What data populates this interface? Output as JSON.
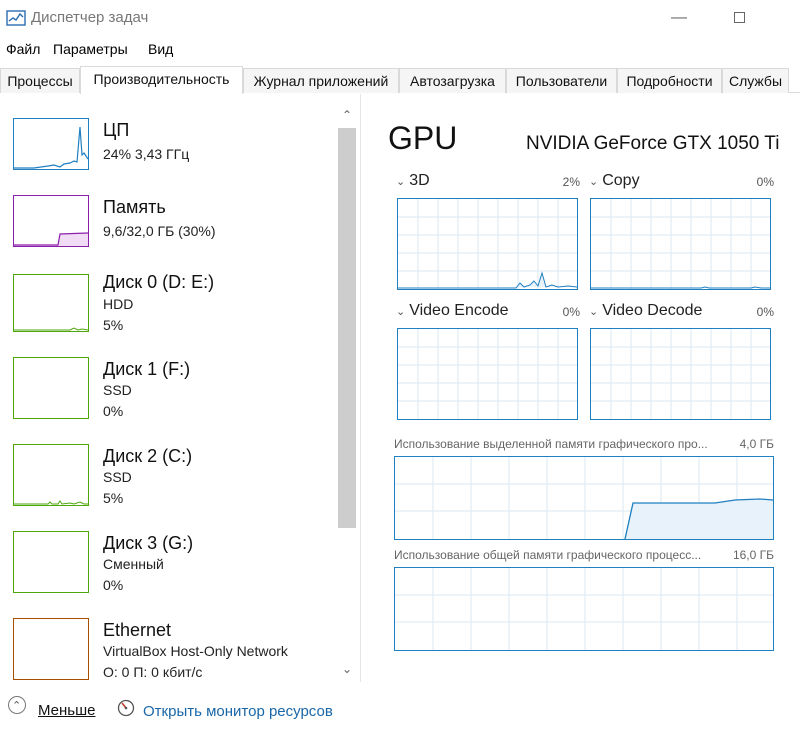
{
  "window": {
    "title": "Диспетчер задач",
    "minimize": "—"
  },
  "menu": {
    "file": "Файл",
    "options": "Параметры",
    "view": "Вид"
  },
  "tabs": [
    {
      "label": "Процессы"
    },
    {
      "label": "Производительность"
    },
    {
      "label": "Журнал приложений"
    },
    {
      "label": "Автозагрузка"
    },
    {
      "label": "Пользователи"
    },
    {
      "label": "Подробности"
    },
    {
      "label": "Службы"
    }
  ],
  "sidebar": {
    "items": [
      {
        "title": "ЦП",
        "line1": "24% 3,43 ГГц",
        "line2": "",
        "color": "#1f7fc1"
      },
      {
        "title": "Память",
        "line1": "9,6/32,0 ГБ (30%)",
        "line2": "",
        "color": "#8b1fa9"
      },
      {
        "title": "Диск 0 (D: E:)",
        "line1": "HDD",
        "line2": "5%",
        "color": "#4da60c"
      },
      {
        "title": "Диск 1 (F:)",
        "line1": "SSD",
        "line2": "0%",
        "color": "#4da60c"
      },
      {
        "title": "Диск 2 (C:)",
        "line1": "SSD",
        "line2": "5%",
        "color": "#4da60c"
      },
      {
        "title": "Диск 3 (G:)",
        "line1": "Сменный",
        "line2": "0%",
        "color": "#4da60c"
      },
      {
        "title": "Ethernet",
        "line1": "VirtualBox Host-Only Network",
        "line2": "О: 0 П: 0 кбит/с",
        "color": "#a74f01"
      }
    ],
    "scroll_up": "⌃",
    "scroll_down": "⌄"
  },
  "gpu": {
    "title": "GPU",
    "name": "NVIDIA GeForce GTX 1050 Ti",
    "engines": [
      {
        "label": "3D",
        "percent": "2%"
      },
      {
        "label": "Copy",
        "percent": "0%"
      },
      {
        "label": "Video Encode",
        "percent": "0%"
      },
      {
        "label": "Video Decode",
        "percent": "0%"
      }
    ],
    "dedicated_label": "Использование выделенной памяти графического про...",
    "dedicated_max": "4,0 ГБ",
    "shared_label": "Использование общей памяти графического процесс...",
    "shared_max": "16,0 ГБ"
  },
  "footer": {
    "less": "Меньше",
    "resource_monitor": "Открыть монитор ресурсов"
  },
  "colors": {
    "gpu_accent": "#1f7fc1",
    "link": "#1a67a8"
  }
}
